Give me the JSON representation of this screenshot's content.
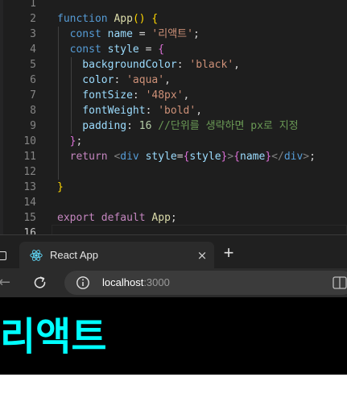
{
  "editor": {
    "lines": [
      {
        "n": "1",
        "tokens": []
      },
      {
        "n": "2",
        "tokens": [
          {
            "t": "function ",
            "c": "kw"
          },
          {
            "t": "App",
            "c": "fn"
          },
          {
            "t": "()",
            "c": "br1"
          },
          {
            "t": " ",
            "c": "pun"
          },
          {
            "t": "{",
            "c": "br1"
          }
        ]
      },
      {
        "n": "3",
        "tokens": [
          {
            "t": "  const ",
            "c": "kw"
          },
          {
            "t": "name",
            "c": "var"
          },
          {
            "t": " = ",
            "c": "pun"
          },
          {
            "t": "'리액트'",
            "c": "str"
          },
          {
            "t": ";",
            "c": "pun"
          }
        ]
      },
      {
        "n": "4",
        "tokens": [
          {
            "t": "  const ",
            "c": "kw"
          },
          {
            "t": "style",
            "c": "var"
          },
          {
            "t": " = ",
            "c": "pun"
          },
          {
            "t": "{",
            "c": "br2"
          }
        ]
      },
      {
        "n": "5",
        "tokens": [
          {
            "t": "    backgroundColor",
            "c": "var"
          },
          {
            "t": ": ",
            "c": "pun"
          },
          {
            "t": "'black'",
            "c": "str"
          },
          {
            "t": ",",
            "c": "pun"
          }
        ]
      },
      {
        "n": "6",
        "tokens": [
          {
            "t": "    color",
            "c": "var"
          },
          {
            "t": ": ",
            "c": "pun"
          },
          {
            "t": "'aqua'",
            "c": "str"
          },
          {
            "t": ",",
            "c": "pun"
          }
        ]
      },
      {
        "n": "7",
        "tokens": [
          {
            "t": "    fontSize",
            "c": "var"
          },
          {
            "t": ": ",
            "c": "pun"
          },
          {
            "t": "'48px'",
            "c": "str"
          },
          {
            "t": ",",
            "c": "pun"
          }
        ]
      },
      {
        "n": "8",
        "tokens": [
          {
            "t": "    fontWeight",
            "c": "var"
          },
          {
            "t": ": ",
            "c": "pun"
          },
          {
            "t": "'bold'",
            "c": "str"
          },
          {
            "t": ",",
            "c": "pun"
          }
        ]
      },
      {
        "n": "9",
        "tokens": [
          {
            "t": "    padding",
            "c": "var"
          },
          {
            "t": ": ",
            "c": "pun"
          },
          {
            "t": "16",
            "c": "num"
          },
          {
            "t": " //단위를 생략하면 px로 지정",
            "c": "cmt"
          }
        ]
      },
      {
        "n": "10",
        "tokens": [
          {
            "t": "  }",
            "c": "br2"
          },
          {
            "t": ";",
            "c": "pun"
          }
        ]
      },
      {
        "n": "11",
        "tokens": [
          {
            "t": "  return ",
            "c": "kw2"
          },
          {
            "t": "<",
            "c": "tag"
          },
          {
            "t": "div",
            "c": "tname"
          },
          {
            "t": " style",
            "c": "var"
          },
          {
            "t": "=",
            "c": "pun"
          },
          {
            "t": "{",
            "c": "br2"
          },
          {
            "t": "style",
            "c": "var"
          },
          {
            "t": "}",
            "c": "br2"
          },
          {
            "t": ">",
            "c": "tag"
          },
          {
            "t": "{",
            "c": "br2"
          },
          {
            "t": "name",
            "c": "var"
          },
          {
            "t": "}",
            "c": "br2"
          },
          {
            "t": "</",
            "c": "tag"
          },
          {
            "t": "div",
            "c": "tname"
          },
          {
            "t": ">",
            "c": "tag"
          },
          {
            "t": ";",
            "c": "pun"
          }
        ]
      },
      {
        "n": "12",
        "tokens": []
      },
      {
        "n": "13",
        "tokens": [
          {
            "t": "}",
            "c": "br1"
          }
        ]
      },
      {
        "n": "14",
        "tokens": []
      },
      {
        "n": "15",
        "tokens": [
          {
            "t": "export ",
            "c": "kw2"
          },
          {
            "t": "default ",
            "c": "kw2"
          },
          {
            "t": "App",
            "c": "fn"
          },
          {
            "t": ";",
            "c": "pun"
          }
        ]
      },
      {
        "n": "16",
        "tokens": [],
        "active": true
      }
    ]
  },
  "browser": {
    "tab_title": "React App",
    "tab_close": "×",
    "new_tab": "+",
    "back": "←",
    "url_host": "localhost",
    "url_port": ":3000"
  },
  "page": {
    "app_name": "리액트",
    "background": "#000000",
    "text_color": "#00ffff"
  }
}
